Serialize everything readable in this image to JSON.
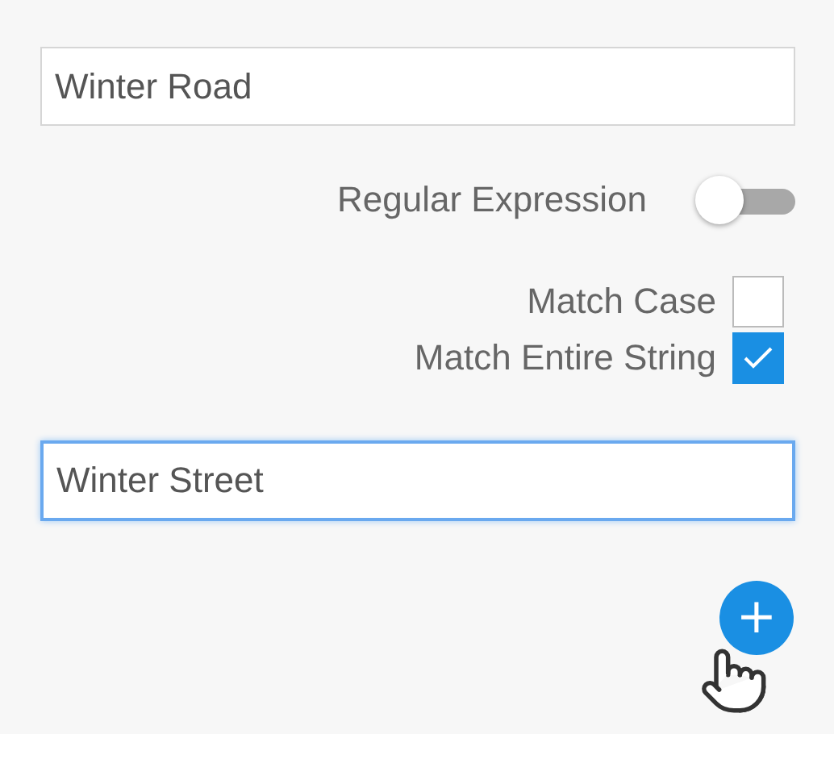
{
  "find_field": {
    "value": "Winter Road",
    "focused": false
  },
  "regex_toggle": {
    "label": "Regular Expression",
    "on": false
  },
  "options": [
    {
      "label": "Match Case",
      "checked": false
    },
    {
      "label": "Match Entire String",
      "checked": true
    }
  ],
  "replace_field": {
    "value": "Winter Street",
    "focused": true
  },
  "add_button": {
    "label": "+"
  }
}
